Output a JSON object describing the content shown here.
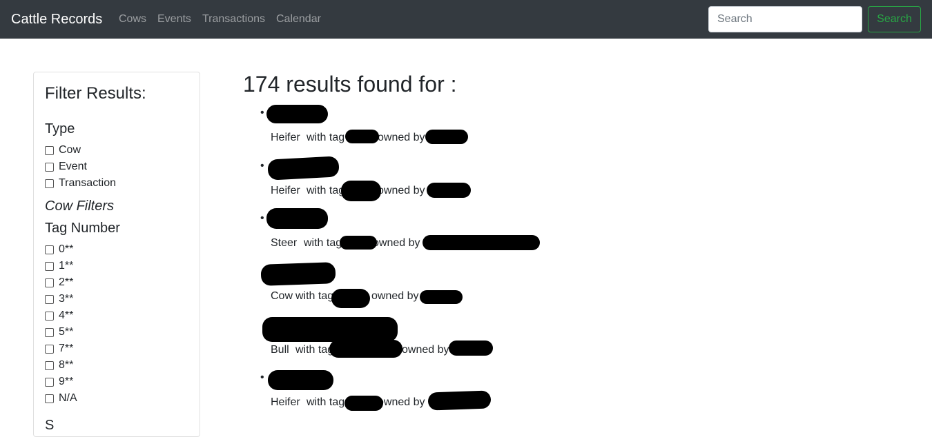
{
  "navbar": {
    "brand": "Cattle Records",
    "links": [
      "Cows",
      "Events",
      "Transactions",
      "Calendar"
    ],
    "search_placeholder": "Search",
    "search_button": "Search"
  },
  "filters": {
    "title": "Filter Results:",
    "type_heading": "Type",
    "type_options": [
      "Cow",
      "Event",
      "Transaction"
    ],
    "cow_filters_heading": "Cow Filters",
    "tag_heading": "Tag Number",
    "tag_options": [
      "0**",
      "1**",
      "2**",
      "3**",
      "4**",
      "5**",
      "7**",
      "8**",
      "9**",
      "N/A"
    ],
    "next_heading_partial": "S"
  },
  "results": {
    "title": "174 results found for :",
    "items": [
      {
        "kind": "Heifer",
        "with_tag": "with tag",
        "owned_by": "owned by"
      },
      {
        "kind": "Heifer",
        "with_tag": "with tag",
        "owned_by": "owned by"
      },
      {
        "kind": "Steer",
        "with_tag": "with tag",
        "owned_by": "owned by"
      },
      {
        "kind": "Cow",
        "with_tag": "with tag",
        "owned_by": "owned by"
      },
      {
        "kind": "Bull",
        "with_tag": "with tag",
        "owned_by": "owned by"
      },
      {
        "kind": "Heifer",
        "with_tag": "with tag",
        "owned_by": "owned by"
      }
    ]
  },
  "colors": {
    "navbar_bg": "#343a40",
    "search_button": "#28a745",
    "redaction": "#000000"
  }
}
